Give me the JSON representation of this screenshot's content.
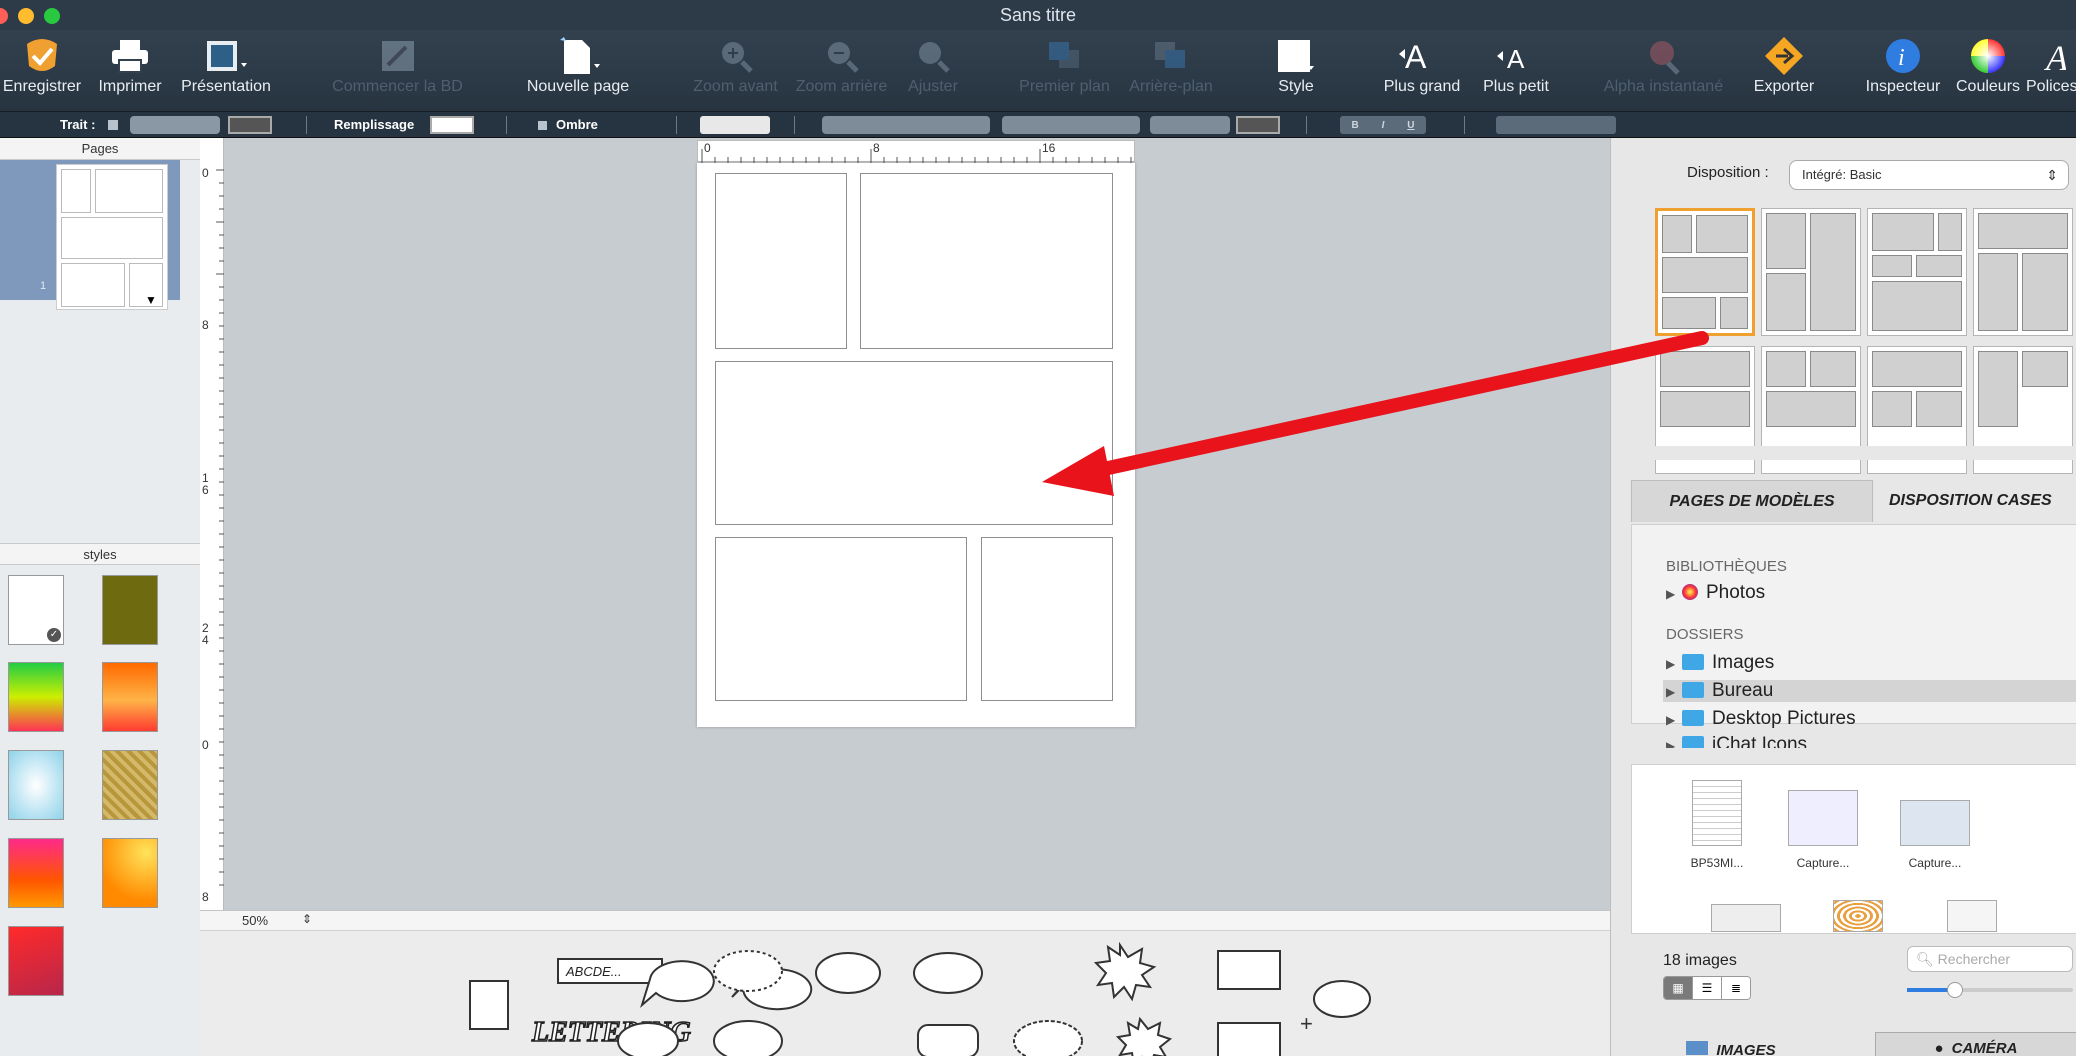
{
  "window": {
    "title": "Sans titre"
  },
  "toolbar": {
    "save": "Enregistrer",
    "print": "Imprimer",
    "presentation": "Présentation",
    "start_comic": "Commencer la BD",
    "new_page": "Nouvelle page",
    "zoom_in": "Zoom avant",
    "zoom_out": "Zoom arrière",
    "fit": "Ajuster",
    "foreground": "Premier plan",
    "background": "Arrière-plan",
    "style": "Style",
    "bigger": "Plus grand",
    "smaller": "Plus petit",
    "alpha": "Alpha instantané",
    "export": "Exporter",
    "inspector": "Inspecteur",
    "colors": "Couleurs",
    "fonts": "Polices"
  },
  "format_bar": {
    "stroke": "Trait :",
    "fill": "Remplissage",
    "shadow": "Ombre",
    "bold": "B",
    "italic": "I",
    "underline": "U"
  },
  "left_panel": {
    "pages_title": "Pages",
    "page_number": "1",
    "styles_title": "styles"
  },
  "ruler": {
    "top": [
      "0",
      "8",
      "16"
    ],
    "left": [
      "0",
      "8",
      "1 6",
      "2 4",
      "0",
      "8"
    ]
  },
  "zoom": {
    "value": "50%"
  },
  "bottom_tools": {
    "caption_text": "ABCDE...",
    "lettering_text": "LETTERING"
  },
  "right_panel": {
    "disposition_label": "Disposition :",
    "disposition_value": "Intégré: Basic",
    "tab_templates": "PAGES DE MODÈLES",
    "tab_layout": "DISPOSITION CASES",
    "libraries_header": "BIBLIOTHÈQUES",
    "photos": "Photos",
    "folders_header": "DOSSIERS",
    "folders": [
      "Images",
      "Bureau",
      "Desktop Pictures",
      "iChat Icons"
    ],
    "thumbs": [
      "BP53MI...",
      "Capture...",
      "Capture..."
    ],
    "count": "18 images",
    "search_placeholder": "Rechercher",
    "btn_images": "IMAGES",
    "btn_camera": "CAMÉRA"
  },
  "colors": {
    "accent_orange": "#f0a030",
    "arrow_red": "#e8131b",
    "toolbar_bg": "#2d3a47",
    "canvas_bg": "#c7ccd1"
  }
}
